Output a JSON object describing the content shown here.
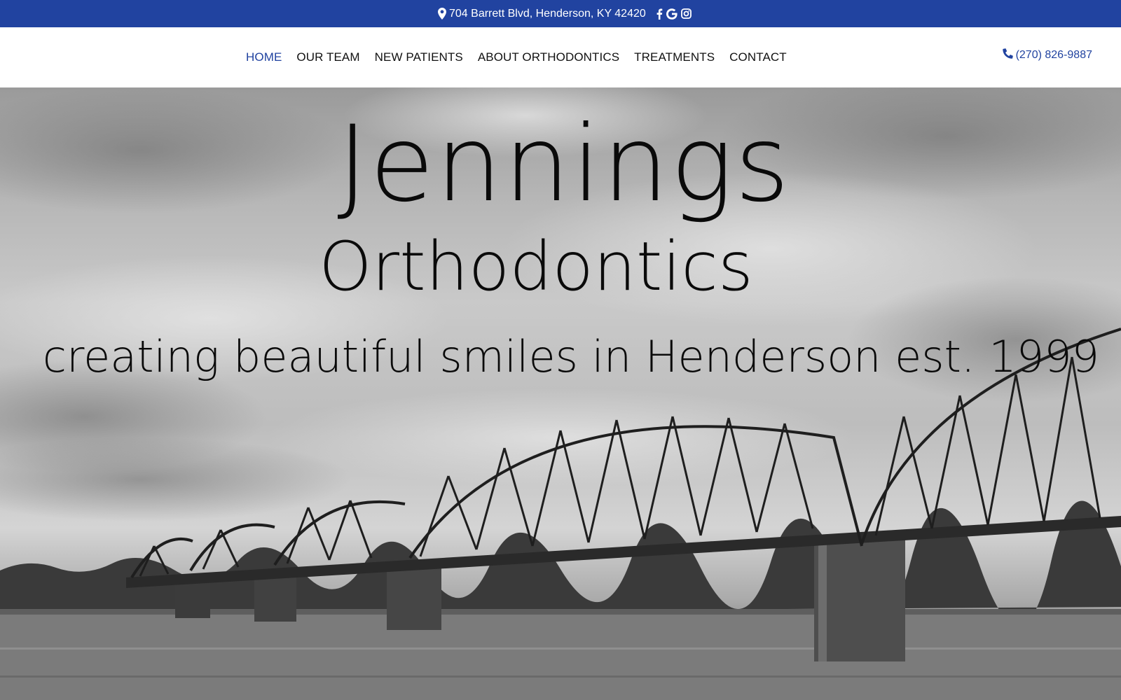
{
  "topbar": {
    "address": "704 Barrett Blvd, Henderson, KY 42420",
    "address_icon": "map-marker-icon",
    "social": [
      "facebook-icon",
      "google-icon",
      "instagram-icon"
    ],
    "color": "#2143a0"
  },
  "nav": {
    "items": [
      {
        "label": "HOME",
        "active": true
      },
      {
        "label": "OUR TEAM"
      },
      {
        "label": "NEW PATIENTS"
      },
      {
        "label": "ABOUT ORTHODONTICS"
      },
      {
        "label": "TREATMENTS"
      },
      {
        "label": "CONTACT"
      }
    ],
    "phone": "(270) 826-9887",
    "phone_icon": "phone-icon"
  },
  "hero": {
    "title": "Jennings",
    "subtitle": "Orthodontics",
    "tagline": "creating beautiful smiles in Henderson est. 1999"
  }
}
